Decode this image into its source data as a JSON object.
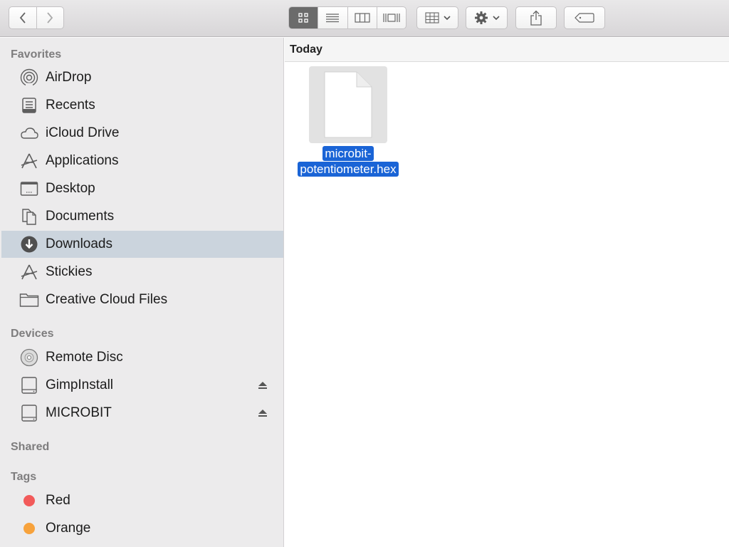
{
  "toolbar": {
    "back_icon": "chevron-left-icon",
    "forward_icon": "chevron-right-icon",
    "view_modes": [
      "icon-view-icon",
      "list-view-icon",
      "column-view-icon",
      "cover-flow-icon"
    ],
    "active_view": "icon",
    "arrange_icon": "arrange-grid-icon",
    "action_icon": "gear-icon",
    "share_icon": "share-icon",
    "tag_icon": "tag-icon"
  },
  "sidebar": {
    "favorites_title": "Favorites",
    "favorites": [
      {
        "label": "AirDrop",
        "icon": "airdrop-icon"
      },
      {
        "label": "Recents",
        "icon": "recents-icon"
      },
      {
        "label": "iCloud Drive",
        "icon": "cloud-icon"
      },
      {
        "label": "Applications",
        "icon": "applications-icon"
      },
      {
        "label": "Desktop",
        "icon": "desktop-icon"
      },
      {
        "label": "Documents",
        "icon": "documents-icon"
      },
      {
        "label": "Downloads",
        "icon": "downloads-icon",
        "selected": true
      },
      {
        "label": "Stickies",
        "icon": "applications-icon"
      },
      {
        "label": "Creative Cloud Files",
        "icon": "folder-icon"
      }
    ],
    "devices_title": "Devices",
    "devices": [
      {
        "label": "Remote Disc",
        "icon": "disc-icon"
      },
      {
        "label": "GimpInstall",
        "icon": "drive-icon",
        "ejectable": true
      },
      {
        "label": "MICROBIT",
        "icon": "drive-icon",
        "ejectable": true
      }
    ],
    "shared_title": "Shared",
    "tags_title": "Tags",
    "tags": [
      {
        "label": "Red",
        "color": "#f25a5a"
      },
      {
        "label": "Orange",
        "color": "#f7a23c"
      }
    ]
  },
  "main": {
    "group_title": "Today",
    "files": [
      {
        "name_line1": "microbit-",
        "name_line2": "potentiometer.hex",
        "selected": true
      }
    ]
  },
  "colors": {
    "selection": "#1a64d6",
    "sidebar_selected": "#cbd4dd",
    "sidebar_bg": "#ecebec"
  }
}
